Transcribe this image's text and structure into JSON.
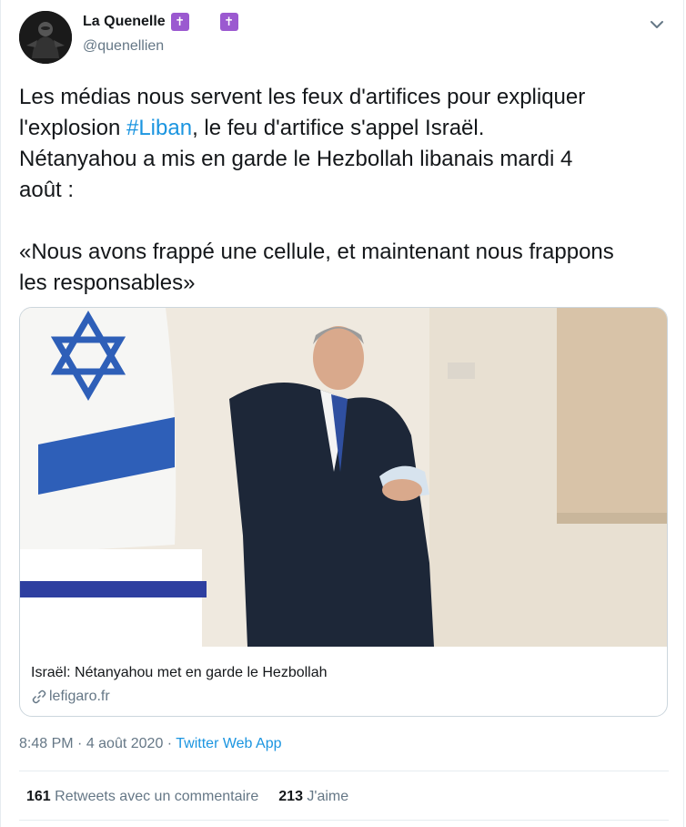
{
  "author": {
    "display_name": "La Quenelle",
    "handle": "@quenellien"
  },
  "tweet": {
    "text_line1": "Les médias nous servent les feux d'artifices pour expliquer",
    "text_line2_pre": "l'explosion ",
    "hashtag": "#Liban",
    "text_line2_post": ", le feu d'artifice s'appel Israël.",
    "text_line3": "Nétanyahou a mis en garde le Hezbollah libanais mardi 4",
    "text_line4": "août :",
    "text_line5": "«Nous avons frappé une cellule, et maintenant nous frappons",
    "text_line6": "les responsables»"
  },
  "card": {
    "title": "Israël: Nétanyahou met en garde le Hezbollah",
    "domain": "lefigaro.fr"
  },
  "meta": {
    "time": "8:48 PM",
    "date": "4 août 2020",
    "separator": " · ",
    "source": "Twitter Web App"
  },
  "stats": {
    "retweets_count": "161",
    "retweets_label": "Retweets avec un commentaire",
    "likes_count": "213",
    "likes_label": "J'aime"
  },
  "icons": {
    "cross": "✝",
    "caret": "chevron-down-icon",
    "link": "link-icon"
  },
  "colors": {
    "accent": "#1b95e0",
    "secondary_text": "#657786",
    "cross_emoji": "#9b59d0"
  }
}
